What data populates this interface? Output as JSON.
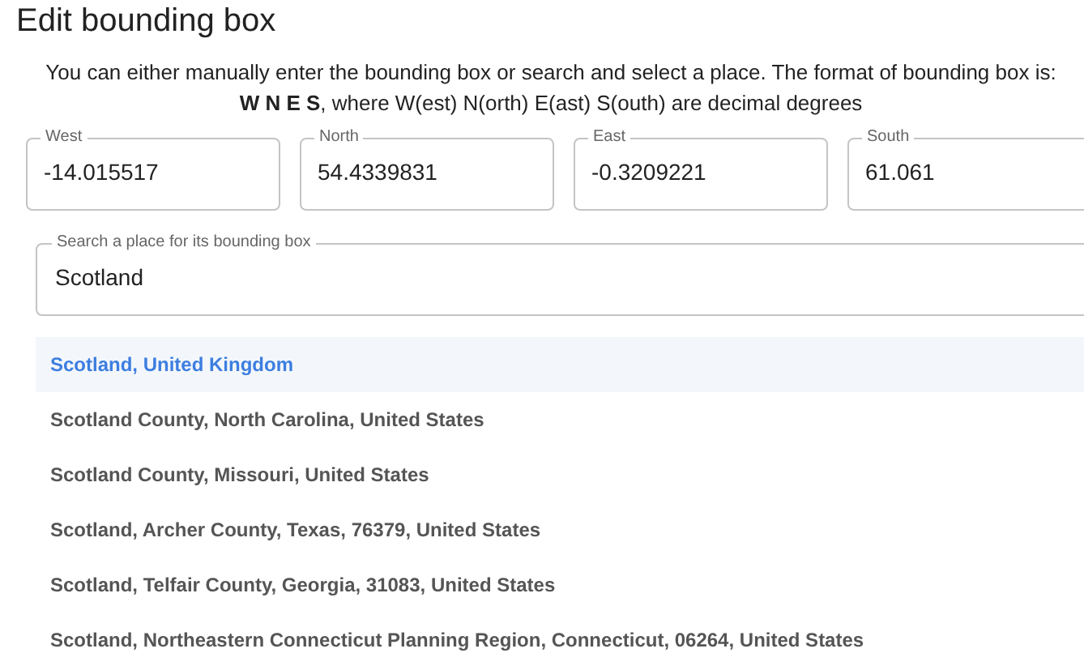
{
  "title": "Edit bounding box",
  "intro": "You can either manually enter the bounding box or search and select a place. The format of bounding box is:",
  "format": "**W N E S**, where W(est) N(orth) E(ast) S(outh) are decimal degrees",
  "fields": [
    {
      "label": "West",
      "value": "-14.015517"
    },
    {
      "label": "North",
      "value": "54.4339831"
    },
    {
      "label": "East",
      "value": "-0.3209221"
    },
    {
      "label": "South",
      "value": "61.061"
    }
  ],
  "search": {
    "label": "Search a place for its bounding box",
    "value": "Scotland"
  },
  "results": [
    {
      "label": "Scotland, United Kingdom",
      "selected": true
    },
    {
      "label": "Scotland County, North Carolina, United States",
      "selected": false
    },
    {
      "label": "Scotland County, Missouri, United States",
      "selected": false
    },
    {
      "label": "Scotland, Archer County, Texas, 76379, United States",
      "selected": false
    },
    {
      "label": "Scotland, Telfair County, Georgia, 31083, United States",
      "selected": false
    },
    {
      "label": "Scotland, Northeastern Connecticut Planning Region, Connecticut, 06264, United States",
      "selected": false
    }
  ]
}
